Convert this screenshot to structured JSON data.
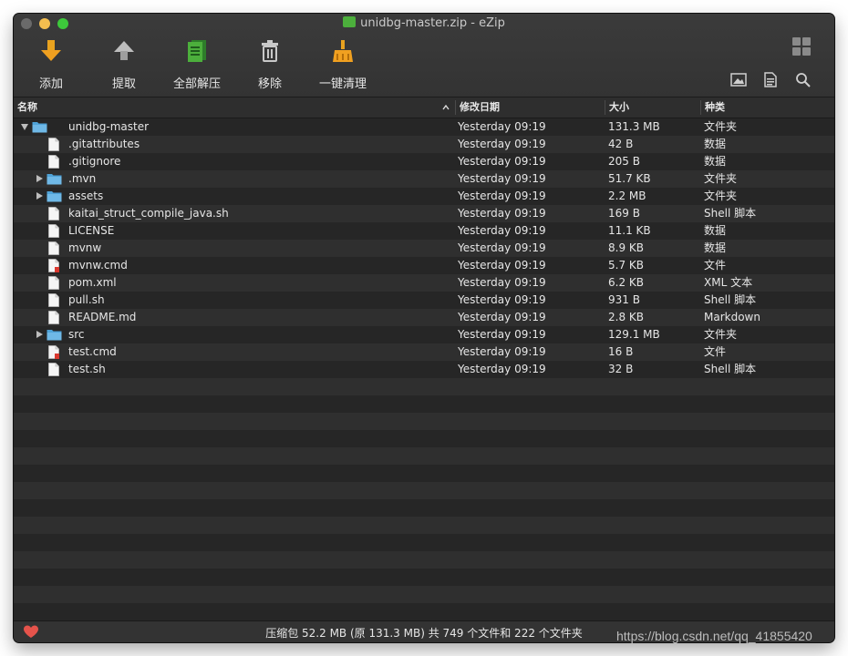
{
  "window": {
    "title": "unidbg-master.zip - eZip"
  },
  "toolbar": {
    "add": "添加",
    "extract": "提取",
    "extract_all": "全部解压",
    "remove": "移除",
    "cleanup": "一键清理"
  },
  "columns": {
    "name": "名称",
    "modified": "修改日期",
    "size": "大小",
    "kind": "种类"
  },
  "files": [
    {
      "name": "unidbg-master",
      "modified": "Yesterday 09:19",
      "size": "131.3 MB",
      "kind": "文件夹",
      "icon": "folder-icon",
      "expander": "open",
      "level": 0
    },
    {
      "name": ".gitattributes",
      "modified": "Yesterday 09:19",
      "size": "42 B",
      "kind": "数据",
      "icon": "document-icon",
      "expander": "none",
      "level": 1
    },
    {
      "name": ".gitignore",
      "modified": "Yesterday 09:19",
      "size": "205 B",
      "kind": "数据",
      "icon": "document-icon",
      "expander": "none",
      "level": 1
    },
    {
      "name": ".mvn",
      "modified": "Yesterday 09:19",
      "size": "51.7 KB",
      "kind": "文件夹",
      "icon": "folder-icon",
      "expander": "closed",
      "level": 1
    },
    {
      "name": "assets",
      "modified": "Yesterday 09:19",
      "size": "2.2 MB",
      "kind": "文件夹",
      "icon": "folder-icon",
      "expander": "closed",
      "level": 1
    },
    {
      "name": "kaitai_struct_compile_java.sh",
      "modified": "Yesterday 09:19",
      "size": "169 B",
      "kind": "Shell 脚本",
      "icon": "document-icon",
      "expander": "none",
      "level": 1
    },
    {
      "name": "LICENSE",
      "modified": "Yesterday 09:19",
      "size": "11.1 KB",
      "kind": "数据",
      "icon": "document-icon",
      "expander": "none",
      "level": 1
    },
    {
      "name": "mvnw",
      "modified": "Yesterday 09:19",
      "size": "8.9 KB",
      "kind": "数据",
      "icon": "document-icon",
      "expander": "none",
      "level": 1
    },
    {
      "name": "mvnw.cmd",
      "modified": "Yesterday 09:19",
      "size": "5.7 KB",
      "kind": "文件",
      "icon": "cmd-file-icon",
      "expander": "none",
      "level": 1
    },
    {
      "name": "pom.xml",
      "modified": "Yesterday 09:19",
      "size": "6.2 KB",
      "kind": "XML 文本",
      "icon": "document-icon",
      "expander": "none",
      "level": 1
    },
    {
      "name": "pull.sh",
      "modified": "Yesterday 09:19",
      "size": "931 B",
      "kind": "Shell 脚本",
      "icon": "document-icon",
      "expander": "none",
      "level": 1
    },
    {
      "name": "README.md",
      "modified": "Yesterday 09:19",
      "size": "2.8 KB",
      "kind": "Markdown",
      "icon": "document-icon",
      "expander": "none",
      "level": 1
    },
    {
      "name": "src",
      "modified": "Yesterday 09:19",
      "size": "129.1 MB",
      "kind": "文件夹",
      "icon": "folder-icon",
      "expander": "closed",
      "level": 1
    },
    {
      "name": "test.cmd",
      "modified": "Yesterday 09:19",
      "size": "16 B",
      "kind": "文件",
      "icon": "cmd-file-icon",
      "expander": "none",
      "level": 1
    },
    {
      "name": "test.sh",
      "modified": "Yesterday 09:19",
      "size": "32 B",
      "kind": "Shell 脚本",
      "icon": "document-icon",
      "expander": "none",
      "level": 1
    }
  ],
  "status": {
    "text": "压缩包 52.2 MB (原 131.3 MB) 共 749 个文件和 222 个文件夹"
  },
  "watermark": "https://blog.csdn.net/qq_41855420",
  "colors": {
    "window_bg": "#2a2a2a",
    "folder": "#4fa3d8",
    "accent_green": "#4caf3c",
    "accent_orange": "#f0a020",
    "heart": "#e5534b"
  }
}
